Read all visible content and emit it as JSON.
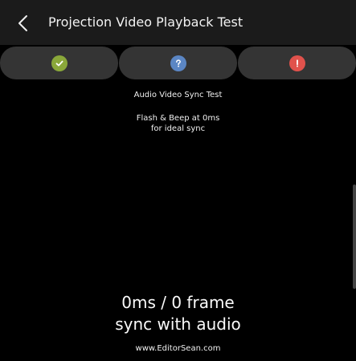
{
  "header": {
    "title": "Projection Video Playback Test",
    "back_icon": "chevron-left-icon"
  },
  "status_buttons": [
    {
      "icon": "check-icon",
      "color": "#8aa83a"
    },
    {
      "icon": "question-icon",
      "color": "#5b86c4"
    },
    {
      "icon": "exclamation-icon",
      "color": "#e0524c"
    }
  ],
  "content": {
    "test_name": "Audio Video Sync Test",
    "instruction_line1": "Flash & Beep at 0ms",
    "instruction_line2": "for ideal sync",
    "sync_value": "0ms / 0 frame",
    "sync_label": "sync with audio",
    "credit": "www.EditorSean.com"
  }
}
